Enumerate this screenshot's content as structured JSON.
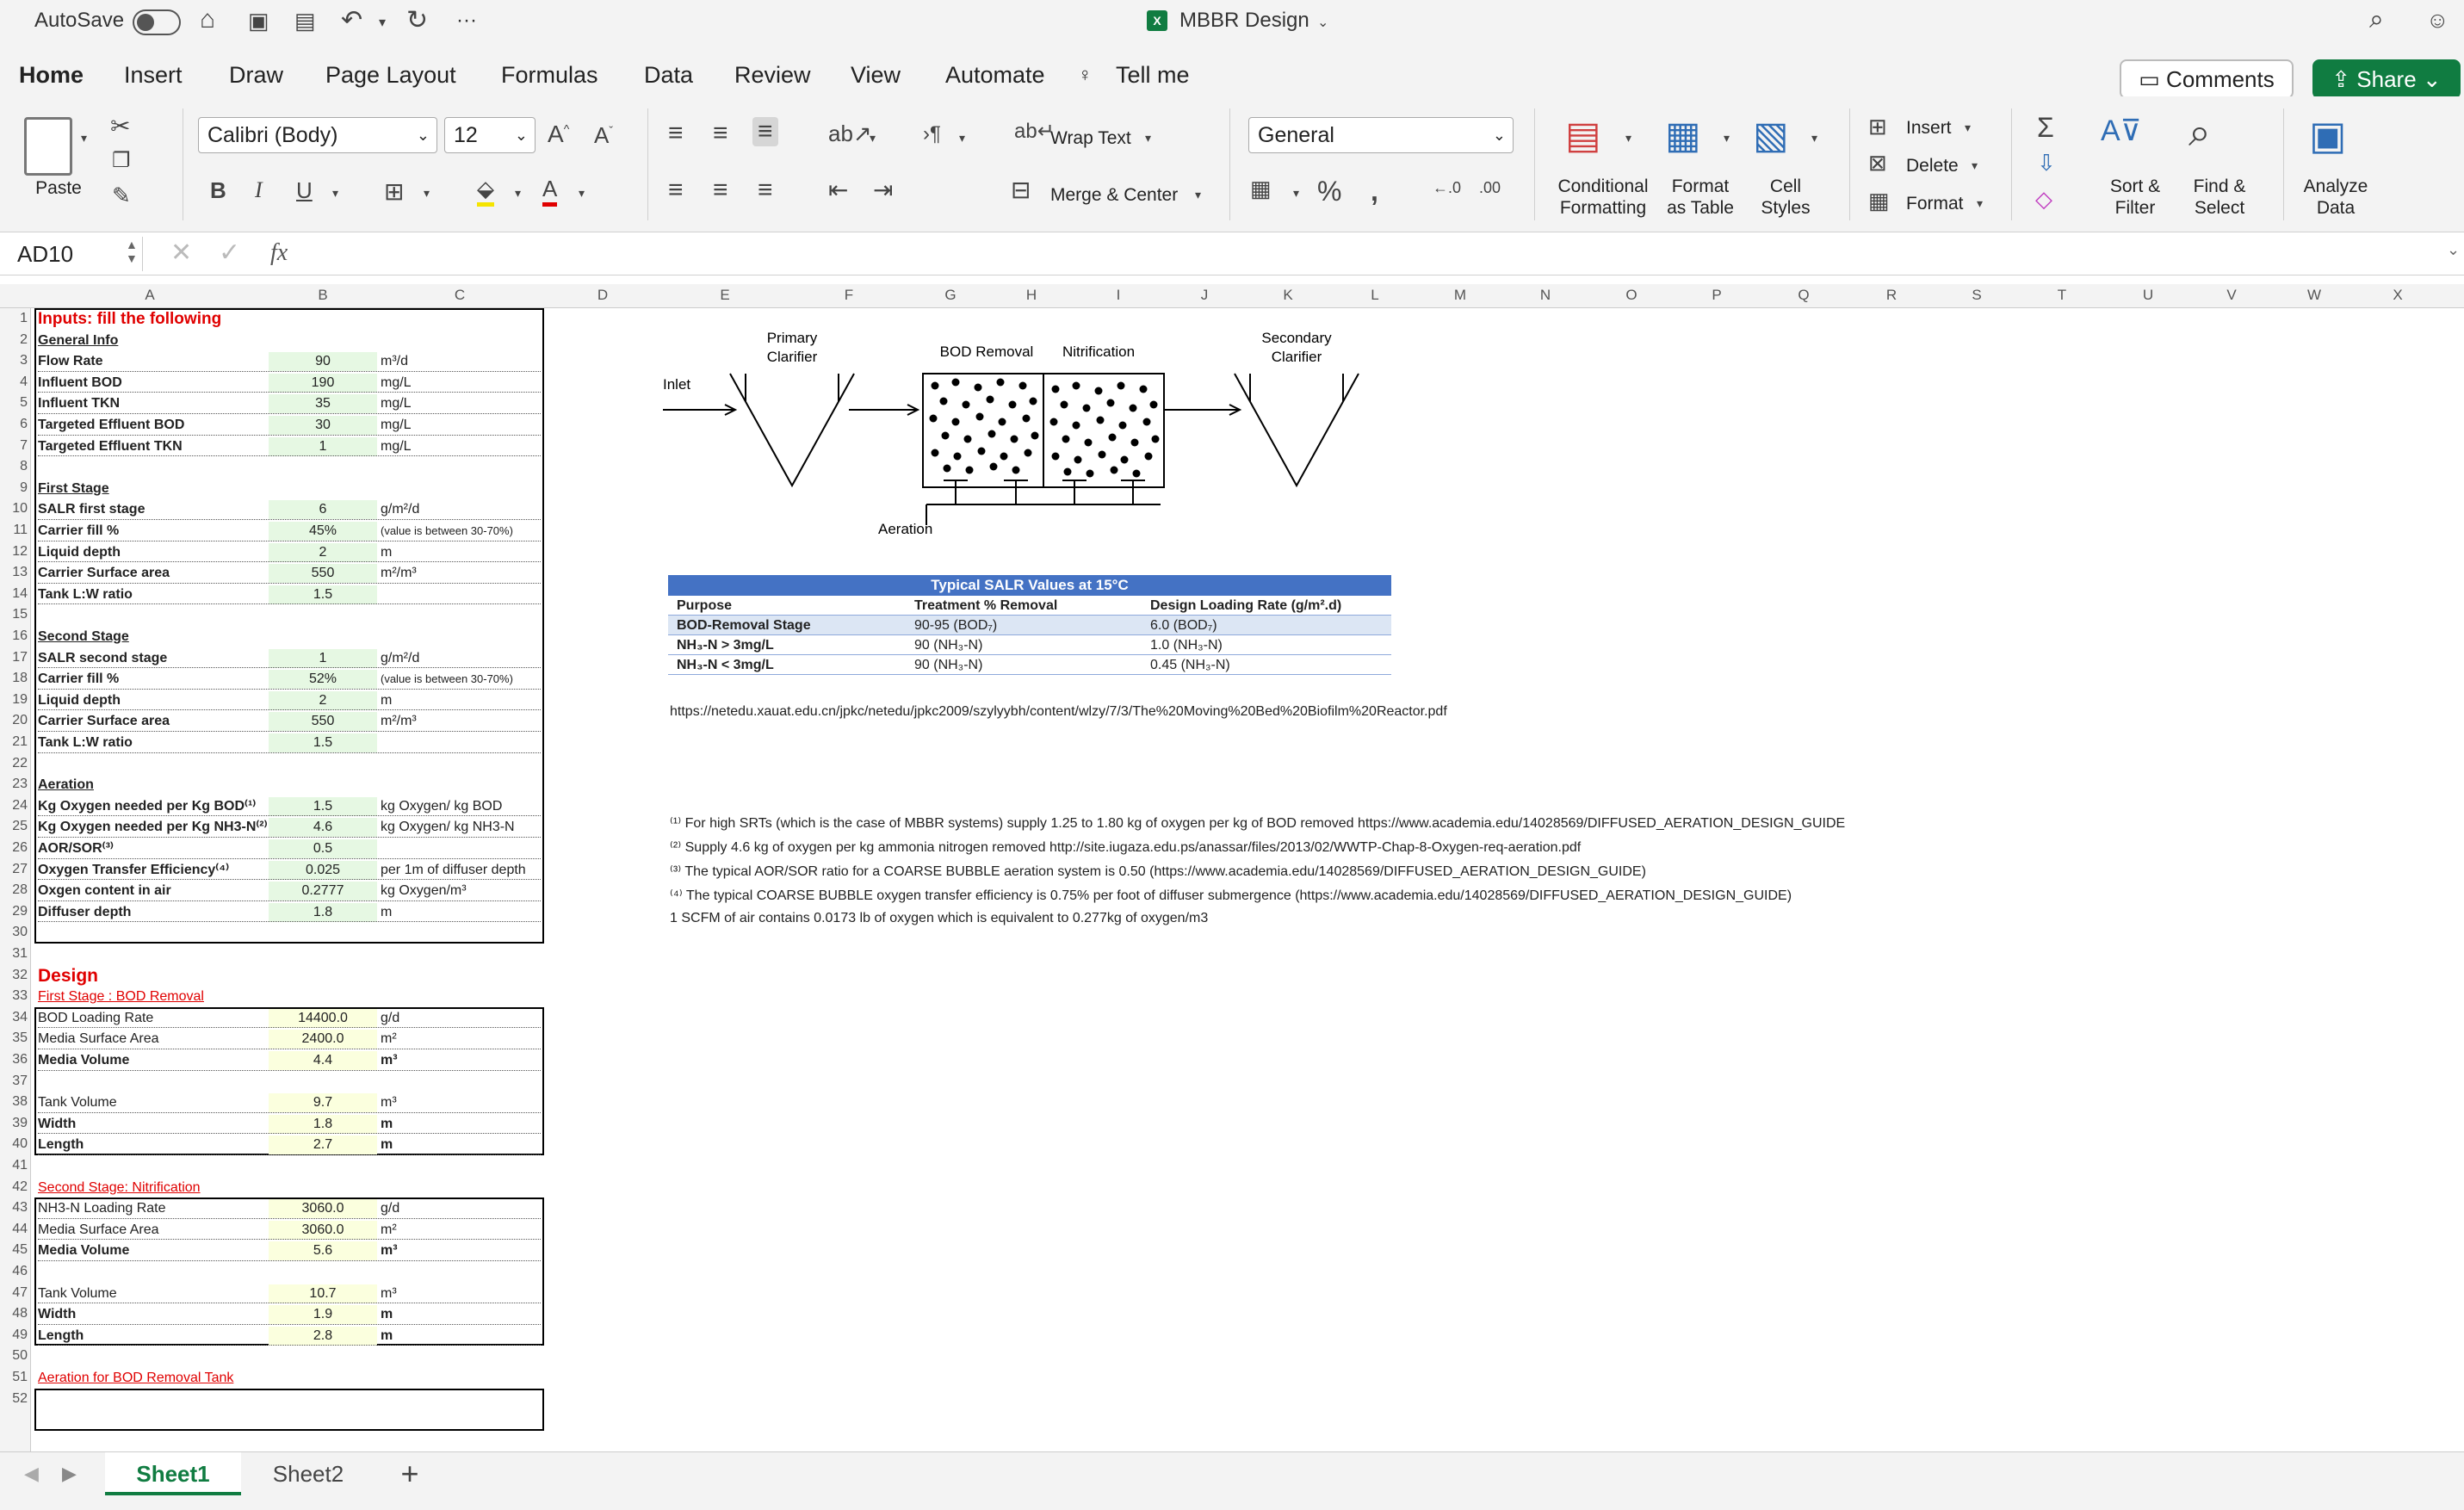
{
  "titlebar": {
    "autosave": "AutoSave",
    "title": "MBBR Design",
    "more": "···"
  },
  "tabs": [
    "Home",
    "Insert",
    "Draw",
    "Page Layout",
    "Formulas",
    "Data",
    "Review",
    "View",
    "Automate",
    "Tell me"
  ],
  "buttons": {
    "comments": "Comments",
    "share": "Share"
  },
  "ribbon": {
    "paste": "Paste",
    "font": "Calibri (Body)",
    "size": "12",
    "wrap": "Wrap Text",
    "merge": "Merge & Center",
    "number_format": "General",
    "cond": [
      "Conditional",
      "Formatting"
    ],
    "fmt_table": [
      "Format",
      "as Table"
    ],
    "cell_styles": [
      "Cell",
      "Styles"
    ],
    "insert": "Insert",
    "delete": "Delete",
    "format": "Format",
    "sort": [
      "Sort &",
      "Filter"
    ],
    "find": [
      "Find &",
      "Select"
    ],
    "analyze": [
      "Analyze",
      "Data"
    ]
  },
  "formula": {
    "namebox": "AD10",
    "fx": "fx"
  },
  "columns": [
    "A",
    "B",
    "C",
    "D",
    "E",
    "F",
    "G",
    "H",
    "I",
    "J",
    "K",
    "L",
    "M",
    "N",
    "O",
    "P",
    "Q",
    "R",
    "S",
    "T",
    "U",
    "V",
    "W",
    "X"
  ],
  "sheet": {
    "inputs_title": "Inputs: fill the following",
    "general_info": "General Info",
    "general": [
      [
        "Flow Rate",
        "90",
        "m³/d"
      ],
      [
        "Influent BOD",
        "190",
        "mg/L"
      ],
      [
        "Influent TKN",
        "35",
        "mg/L"
      ],
      [
        "Targeted Effluent BOD",
        "30",
        "mg/L"
      ],
      [
        "Targeted Effluent TKN",
        "1",
        "mg/L"
      ]
    ],
    "first_stage": "First Stage",
    "first": [
      [
        "SALR first stage",
        "6",
        "g/m²/d"
      ],
      [
        "Carrier fill %",
        "45%",
        "(value is between 30-70%)"
      ],
      [
        "Liquid depth",
        "2",
        "m"
      ],
      [
        "Carrier Surface area",
        "550",
        "m²/m³"
      ],
      [
        "Tank L:W ratio",
        "1.5",
        ""
      ]
    ],
    "second_stage": "Second Stage",
    "second": [
      [
        "SALR second stage",
        "1",
        "g/m²/d"
      ],
      [
        "Carrier fill %",
        "52%",
        "(value is between 30-70%)"
      ],
      [
        "Liquid depth",
        "2",
        "m"
      ],
      [
        "Carrier Surface area",
        "550",
        "m²/m³"
      ],
      [
        "Tank L:W ratio",
        "1.5",
        ""
      ]
    ],
    "aeration": "Aeration",
    "aer": [
      [
        "Kg Oxygen needed per Kg BOD⁽¹⁾",
        "1.5",
        "kg Oxygen/ kg BOD"
      ],
      [
        "Kg Oxygen needed per Kg NH3-N⁽²⁾",
        "4.6",
        "kg Oxygen/ kg NH3-N"
      ],
      [
        "AOR/SOR⁽³⁾",
        "0.5",
        ""
      ],
      [
        "Oxygen Transfer Efficiency⁽⁴⁾",
        "0.025",
        "per 1m of diffuser depth"
      ],
      [
        "Oxgen content in air",
        "0.2777",
        "kg Oxygen/m³"
      ],
      [
        "Diffuser depth",
        "1.8",
        "m"
      ]
    ],
    "design": "Design",
    "stage1_title": "First Stage : BOD Removal",
    "stage1a": [
      [
        "BOD Loading Rate",
        "14400.0",
        "g/d"
      ],
      [
        "Media Surface Area",
        "2400.0",
        "m²"
      ],
      [
        "Media Volume",
        "4.4",
        "m³"
      ]
    ],
    "stage1b": [
      [
        "Tank Volume",
        "9.7",
        "m³"
      ],
      [
        "Width",
        "1.8",
        "m"
      ],
      [
        "Length",
        "2.7",
        "m"
      ]
    ],
    "stage2_title": "Second Stage: Nitrification",
    "stage2a": [
      [
        "NH3-N Loading Rate",
        "3060.0",
        "g/d"
      ],
      [
        "Media Surface Area",
        "3060.0",
        "m²"
      ],
      [
        "Media Volume",
        "5.6",
        "m³"
      ]
    ],
    "stage2b": [
      [
        "Tank Volume",
        "10.7",
        "m³"
      ],
      [
        "Width",
        "1.9",
        "m"
      ],
      [
        "Length",
        "2.8",
        "m"
      ]
    ],
    "aer_title": "Aeration for BOD Removal Tank"
  },
  "diagram": {
    "primary": [
      "Primary",
      "Clarifier"
    ],
    "bod": "BOD Removal",
    "nit": "Nitrification",
    "secondary": [
      "Secondary",
      "Clarifier"
    ],
    "inlet": "Inlet",
    "aeration": "Aeration"
  },
  "salr_table": {
    "title": "Typical SALR Values at 15°C",
    "headers": [
      "Purpose",
      "Treatment % Removal",
      "Design Loading Rate (g/m².d)"
    ],
    "rows": [
      [
        "BOD-Removal Stage",
        "90-95 (BOD₇)",
        "6.0 (BOD₇)"
      ],
      [
        "NH₃-N > 3mg/L",
        "90 (NH₃-N)",
        "1.0 (NH₃-N)"
      ],
      [
        "NH₃-N < 3mg/L",
        "90 (NH₃-N)",
        "0.45 (NH₃-N)"
      ]
    ]
  },
  "url": "https://netedu.xauat.edu.cn/jpkc/netedu/jpkc2009/szylyybh/content/wlzy/7/3/The%20Moving%20Bed%20Biofilm%20Reactor.pdf",
  "footnotes": [
    "⁽¹⁾ For high SRTs (which is the case of MBBR systems) supply 1.25 to 1.80 kg of oxygen per kg of BOD removed https://www.academia.edu/14028569/DIFFUSED_AERATION_DESIGN_GUIDE",
    "⁽²⁾ Supply 4.6 kg of oxygen per kg ammonia nitrogen removed  http://site.iugaza.edu.ps/anassar/files/2013/02/WWTP-Chap-8-Oxygen-req-aeration.pdf",
    "⁽³⁾ The typical AOR/SOR ratio for a COARSE BUBBLE aeration system is 0.50 (https://www.academia.edu/14028569/DIFFUSED_AERATION_DESIGN_GUIDE)",
    "⁽⁴⁾ The typical COARSE BUBBLE oxygen transfer efficiency is 0.75% per foot of diffuser submergence (https://www.academia.edu/14028569/DIFFUSED_AERATION_DESIGN_GUIDE)",
    "1 SCFM of air contains 0.0173 lb of oxygen which is equivalent to 0.277kg of oxygen/m3"
  ],
  "sheets": [
    "Sheet1",
    "Sheet2"
  ],
  "colors": {
    "accent": "#107c41",
    "table_header": "#4472c4",
    "input_fill": "#e6f8e3"
  }
}
